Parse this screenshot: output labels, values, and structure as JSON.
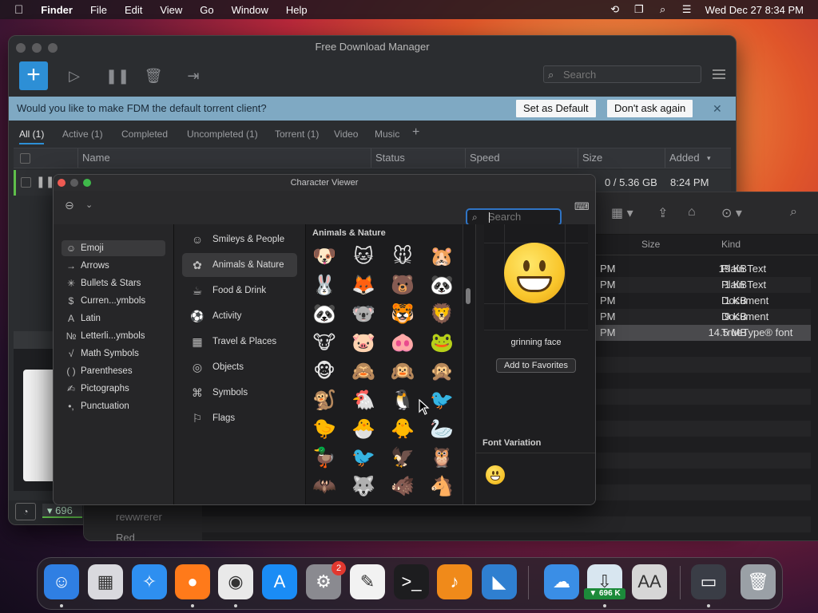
{
  "menubar": {
    "app": "Finder",
    "items": [
      "File",
      "Edit",
      "View",
      "Go",
      "Window",
      "Help"
    ],
    "clock": "Wed Dec 27  8:34 PM"
  },
  "fdm": {
    "title": "Free Download Manager",
    "search_placeholder": "Search",
    "banner_text": "Would you like to make FDM the default torrent client?",
    "set_default": "Set as Default",
    "dont_ask": "Don't ask again",
    "tabs": [
      "All (1)",
      "Active (1)",
      "Completed",
      "Uncompleted (1)",
      "Torrent (1)",
      "Video",
      "Music",
      "+"
    ],
    "columns": [
      "Name",
      "Status",
      "Speed",
      "Size",
      "Added"
    ],
    "row": {
      "size": "0 / 5.36 GB",
      "added": "8:24 PM"
    },
    "speed": "696"
  },
  "finder": {
    "columns": [
      "Size",
      "Kind"
    ],
    "rows": [
      {
        "time": "PM",
        "size": "19 KB",
        "kind": "Plain Text"
      },
      {
        "time": "PM",
        "size": "1 KB",
        "kind": "Plain Text"
      },
      {
        "time": "PM",
        "size": "1 KB",
        "kind": "Document"
      },
      {
        "time": "PM",
        "size": "9 KB",
        "kind": "Document"
      },
      {
        "time": "PM",
        "size": "14.5 MB",
        "kind": "TrueType® font"
      }
    ],
    "sidebar_tags": [
      "rewwrerer",
      "Red"
    ]
  },
  "charviewer": {
    "title": "Character Viewer",
    "search_placeholder": "Search",
    "categories": [
      {
        "label": "Emoji",
        "icon": "☺"
      },
      {
        "label": "Arrows",
        "icon": "→"
      },
      {
        "label": "Bullets & Stars",
        "icon": "✳"
      },
      {
        "label": "Curren...ymbols",
        "icon": "$"
      },
      {
        "label": "Latin",
        "icon": "A"
      },
      {
        "label": "Letterli...ymbols",
        "icon": "№"
      },
      {
        "label": "Math Symbols",
        "icon": "√"
      },
      {
        "label": "Parentheses",
        "icon": "( )"
      },
      {
        "label": "Pictographs",
        "icon": "✍"
      },
      {
        "label": "Punctuation",
        "icon": "•,"
      }
    ],
    "subcategories": [
      {
        "label": "Smileys & People",
        "icon": "☺"
      },
      {
        "label": "Animals & Nature",
        "icon": "✿"
      },
      {
        "label": "Food & Drink",
        "icon": "☕"
      },
      {
        "label": "Activity",
        "icon": "⚽"
      },
      {
        "label": "Travel & Places",
        "icon": "▦"
      },
      {
        "label": "Objects",
        "icon": "◎"
      },
      {
        "label": "Symbols",
        "icon": "⌘"
      },
      {
        "label": "Flags",
        "icon": "⚐"
      }
    ],
    "section_title": "Animals & Nature",
    "emoji_grid": [
      [
        "🐶",
        "🐱",
        "🐭",
        "🐹"
      ],
      [
        "🐰",
        "🦊",
        "🐻",
        "🐼"
      ],
      [
        "🐼",
        "🐨",
        "🐯",
        "🦁"
      ],
      [
        "🐮",
        "🐷",
        "🐽",
        "🐸"
      ],
      [
        "🐵",
        "🙈",
        "🙉",
        "🙊"
      ],
      [
        "🐒",
        "🐔",
        "🐧",
        "🐦"
      ],
      [
        "🐤",
        "🐣",
        "🐥",
        "🦢"
      ],
      [
        "🦆",
        "🐦",
        "🦅",
        "🦉"
      ],
      [
        "🦇",
        "🐺",
        "🐗",
        "🐴"
      ]
    ],
    "selected_name": "grinning face",
    "add_favorites": "Add to Favorites",
    "font_variation": "Font Variation"
  },
  "dock": {
    "apps": [
      {
        "name": "Finder",
        "icon": "☺",
        "color": "#2f7fe3"
      },
      {
        "name": "Launchpad",
        "icon": "▦",
        "color": "#d9d9de"
      },
      {
        "name": "Safari",
        "icon": "✧",
        "color": "#2e8ff0"
      },
      {
        "name": "Firefox",
        "icon": "●",
        "color": "#ff7a1a"
      },
      {
        "name": "Chrome",
        "icon": "◉",
        "color": "#e9e9e9"
      },
      {
        "name": "App Store",
        "icon": "A",
        "color": "#1a8cf5"
      },
      {
        "name": "System Settings",
        "icon": "⚙",
        "color": "#8a8a90"
      },
      {
        "name": "TextEdit",
        "icon": "✎",
        "color": "#f2f2f2"
      },
      {
        "name": "Terminal",
        "icon": ">_",
        "color": "#1d1d1f"
      },
      {
        "name": "GarageBand",
        "icon": "♪",
        "color": "#f08a1a"
      },
      {
        "name": "VS Code",
        "icon": "◣",
        "color": "#2f7fd0"
      },
      {
        "name": "Weather",
        "icon": "☁",
        "color": "#3a8ee6"
      },
      {
        "name": "Free Download Manager",
        "icon": "⇩",
        "color": "#d8e6f0"
      },
      {
        "name": "Font Book",
        "icon": "AA",
        "color": "#d6d6d6"
      },
      {
        "name": "Screen",
        "icon": "▭",
        "color": "#3a3d46"
      },
      {
        "name": "Trash",
        "icon": "🗑",
        "color": "#9aa0a6"
      }
    ],
    "settings_badge": "2",
    "fdm_badge": "▼ 696 K"
  }
}
